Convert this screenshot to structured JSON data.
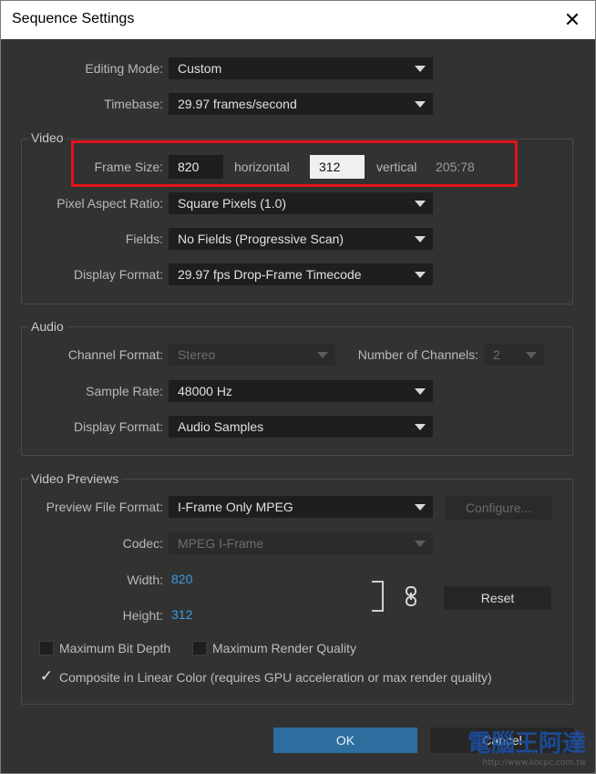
{
  "window": {
    "title": "Sequence Settings",
    "close_glyph": "✕"
  },
  "top": {
    "editing_mode": {
      "label": "Editing Mode:",
      "value": "Custom"
    },
    "timebase": {
      "label": "Timebase:",
      "value": "29.97  frames/second"
    }
  },
  "video": {
    "title": "Video",
    "frame_size": {
      "label": "Frame Size:",
      "horizontal": "820",
      "horizontal_label": "horizontal",
      "vertical": "312",
      "vertical_label": "vertical",
      "aspect": "205:78"
    },
    "pixel_aspect": {
      "label": "Pixel Aspect Ratio:",
      "value": "Square Pixels (1.0)"
    },
    "fields": {
      "label": "Fields:",
      "value": "No Fields (Progressive Scan)"
    },
    "display_format": {
      "label": "Display Format:",
      "value": "29.97 fps Drop-Frame Timecode"
    }
  },
  "audio": {
    "title": "Audio",
    "channel_format": {
      "label": "Channel Format:",
      "value": "Stereo"
    },
    "num_channels": {
      "label": "Number of Channels:",
      "value": "2"
    },
    "sample_rate": {
      "label": "Sample Rate:",
      "value": "48000 Hz"
    },
    "display_format": {
      "label": "Display Format:",
      "value": "Audio Samples"
    }
  },
  "previews": {
    "title": "Video Previews",
    "file_format": {
      "label": "Preview File Format:",
      "value": "I-Frame Only MPEG"
    },
    "configure_label": "Configure...",
    "codec": {
      "label": "Codec:",
      "value": "MPEG I-Frame"
    },
    "width": {
      "label": "Width:",
      "value": "820"
    },
    "height": {
      "label": "Height:",
      "value": "312"
    },
    "reset_label": "Reset",
    "max_bit_depth": {
      "label": "Maximum Bit Depth",
      "checked": false
    },
    "max_render_quality": {
      "label": "Maximum Render Quality",
      "checked": false
    },
    "composite_linear": {
      "label": "Composite in Linear Color (requires GPU acceleration or max render quality)",
      "checked": true,
      "check_glyph": "✓"
    }
  },
  "buttons": {
    "ok": "OK",
    "cancel": "Cancel"
  },
  "watermark": {
    "text": "電腦王阿達",
    "url": "http://www.kocpc.com.tw"
  },
  "colors": {
    "accent": "#2d6e9e",
    "highlight": "#e0141b",
    "link_value": "#3a9ce6"
  }
}
